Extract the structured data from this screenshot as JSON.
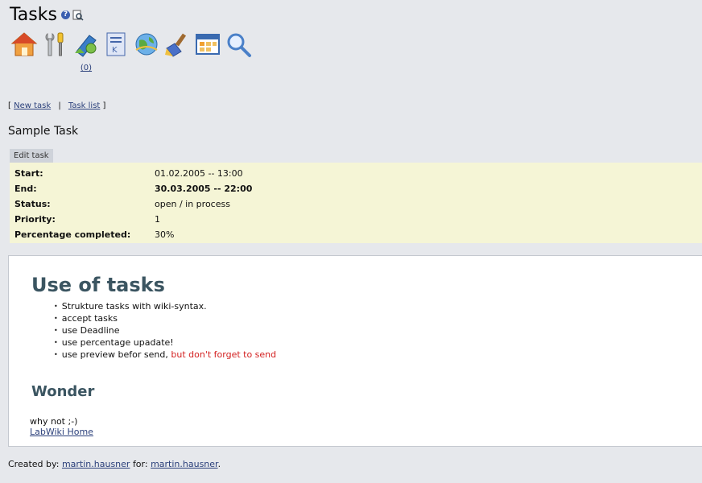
{
  "header": {
    "title": "Tasks"
  },
  "toolbar": {
    "icons": [
      "home-icon",
      "tools-icon",
      "tasks-icon",
      "notes-icon",
      "globe-icon",
      "cleanup-icon",
      "calendar-icon",
      "search-icon"
    ],
    "task_count": "(0)"
  },
  "nav": {
    "open_bracket": "[",
    "new_task": "New task",
    "sep": "|",
    "task_list": "Task list",
    "close_bracket": "]"
  },
  "task": {
    "title": "Sample Task",
    "edit_label": "Edit task",
    "props": [
      {
        "label": "Start:",
        "value": "01.02.2005 -- 13:00"
      },
      {
        "label": "End:",
        "value": "30.03.2005 -- 22:00"
      },
      {
        "label": "Status:",
        "value": "open / in process"
      },
      {
        "label": "Priority:",
        "value": "1"
      },
      {
        "label": "Percentage completed:",
        "value": "30%"
      }
    ]
  },
  "content": {
    "heading1": "Use of tasks",
    "bullets": [
      "Strukture tasks with wiki-syntax.",
      "accept tasks",
      "use Deadline",
      "use percentage upadate!"
    ],
    "bullet5_prefix": "use preview befor send, ",
    "bullet5_red": "but don't forget to send",
    "heading2": "Wonder",
    "para": "why not ;-)",
    "home_link": "LabWiki Home"
  },
  "footer": {
    "created_by_label": "Created by:",
    "created_by": "martin.hausner",
    "for_label": "for:",
    "for_user": "martin.hausner",
    "end": "."
  },
  "colors": {
    "background": "#e6e8ec",
    "props_bg": "#f5f5d6",
    "heading": "#3b5561",
    "link": "#2a3f7a",
    "warning": "#d32020"
  }
}
